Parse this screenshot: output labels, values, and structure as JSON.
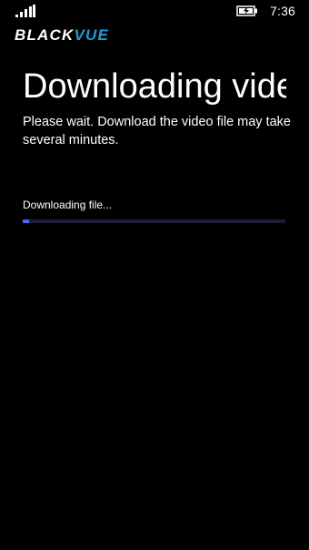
{
  "status_bar": {
    "signal_icon": "signal-strength-icon",
    "battery_icon": "battery-charging-icon",
    "time": "7:36"
  },
  "brand": {
    "part1": "BLACK",
    "part2": "VUE",
    "color_primary": "#ffffff",
    "color_accent": "#1e9bd7"
  },
  "page": {
    "title": "Downloading video",
    "message": "Please wait. Download the video file may take several minutes."
  },
  "download": {
    "label": "Downloading file...",
    "progress_fraction": 0.025,
    "progress_color": "#4a66ff",
    "track_color": "#1d1d3a"
  }
}
